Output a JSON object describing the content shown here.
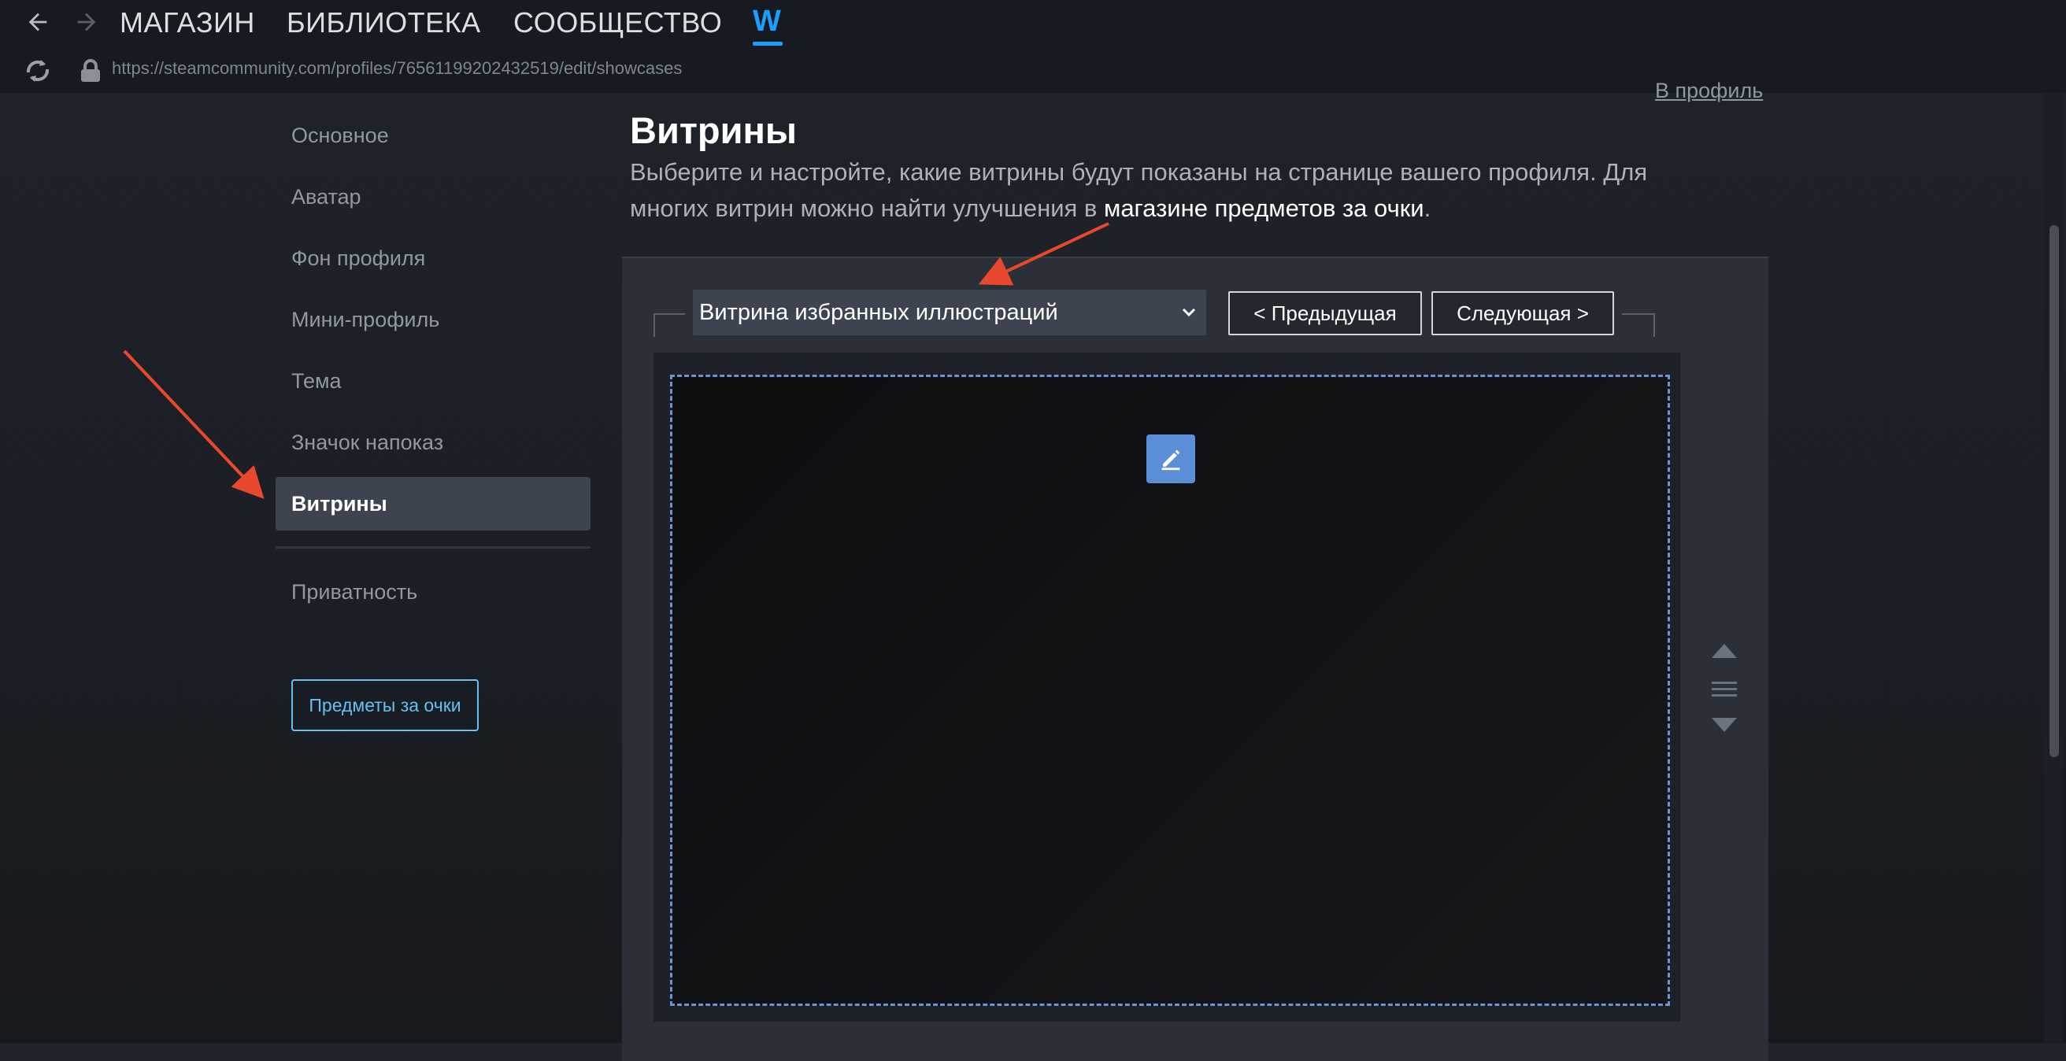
{
  "topnav": {
    "store": "МАГАЗИН",
    "library": "БИБЛИОТЕКА",
    "community": "СООБЩЕСТВО",
    "user": "W"
  },
  "urlbar": {
    "url": "https://steamcommunity.com/profiles/76561199202432519/edit/showcases"
  },
  "sidebar": {
    "items": [
      {
        "label": "Основное"
      },
      {
        "label": "Аватар"
      },
      {
        "label": "Фон профиля"
      },
      {
        "label": "Мини-профиль"
      },
      {
        "label": "Тема"
      },
      {
        "label": "Значок напоказ"
      },
      {
        "label": "Витрины"
      },
      {
        "label": "Приватность"
      }
    ],
    "active_item": "Витрины",
    "points_shop_button": "Предметы за очки"
  },
  "main": {
    "to_profile_link": "В профиль",
    "title": "Витрины",
    "description_prefix": "Выберите и настройте, какие витрины будут показаны на странице вашего профиля. Для многих витрин можно найти улучшения в ",
    "description_link": "магазине предметов за очки",
    "description_suffix": "."
  },
  "showcase": {
    "selected_type": "Витрина избранных иллюстраций",
    "prev_button": "< Предыдущая",
    "next_button": "Следующая >"
  },
  "icons": {
    "back": "arrow-left-icon",
    "forward": "arrow-right-icon",
    "refresh": "refresh-icon",
    "lock": "lock-icon",
    "select_chevron": "chevron-down-icon",
    "edit": "pencil-icon",
    "reorder": "reorder-handle-icon"
  },
  "colors": {
    "accent_blue": "#1a9fff",
    "link_blue": "#66c0f4",
    "edit_button": "#5b8ed6",
    "dashed_border": "#6b93d6",
    "annotation_arrow": "#e8482e",
    "active_nav_bg": "#3d4450"
  }
}
